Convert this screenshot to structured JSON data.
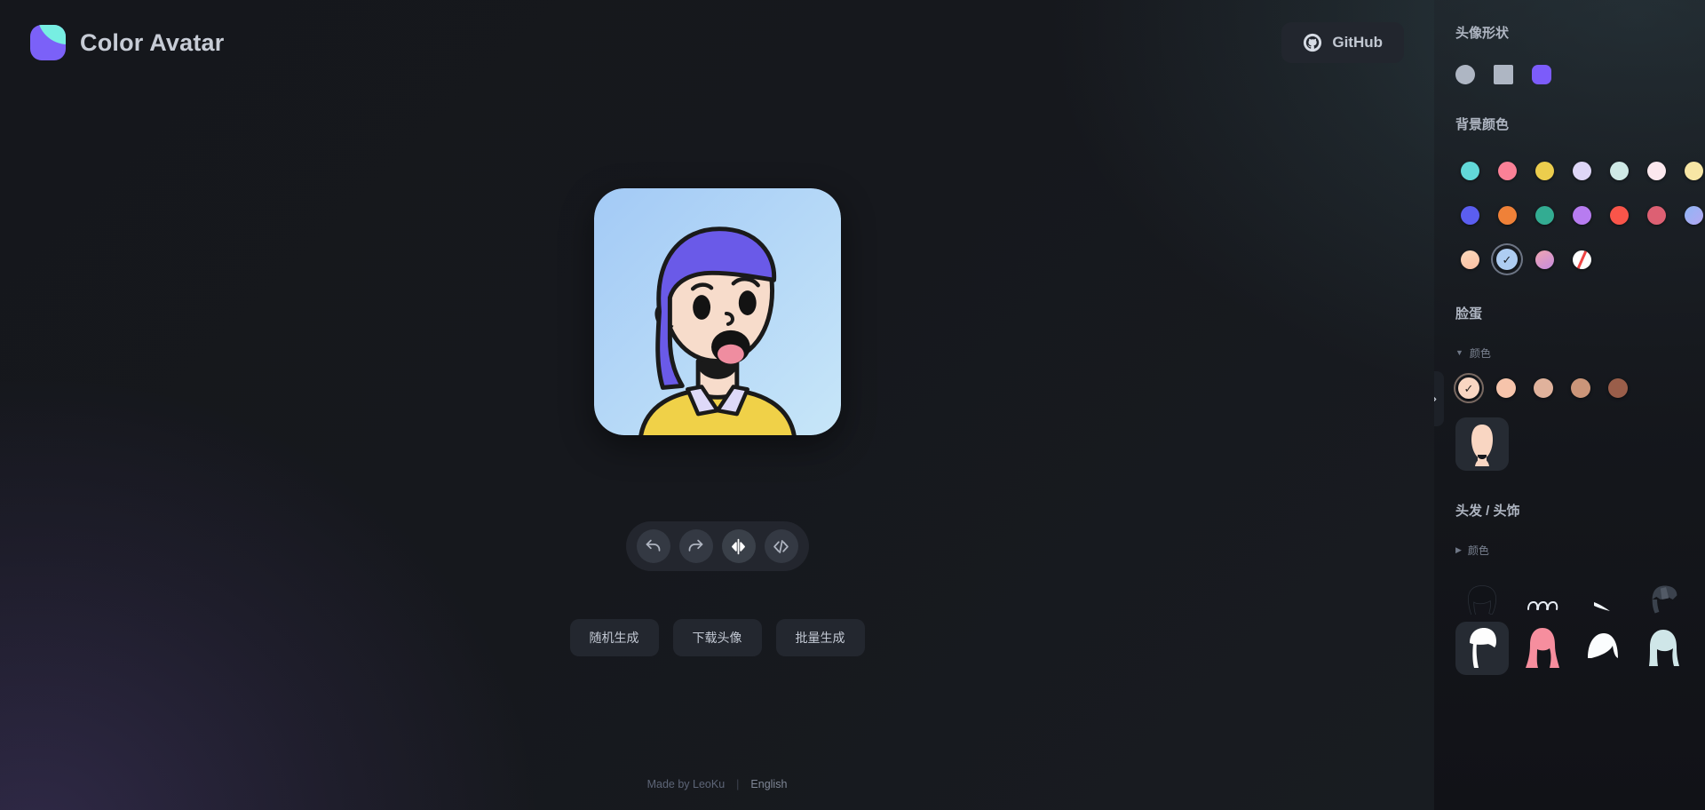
{
  "app": {
    "brand_title": "Color Avatar",
    "logo_icon": "color-avatar-logo",
    "logo_colors": {
      "base": "#7b61f8",
      "accent": "#77eee2"
    }
  },
  "header": {
    "github_label": "GitHub",
    "github_icon": "github-icon"
  },
  "preview": {
    "shape": "rounded-square",
    "background": {
      "type": "linear-gradient",
      "from": "#a5cbf5",
      "to": "#c5e4f7"
    },
    "skin": "#f7dccb",
    "hair_color": "#6a5ae8",
    "shirt_color": "#f0d148",
    "collar_color": "#ded9f8",
    "mouth_color": "#ef8da0",
    "outline_color": "#1a1a1a"
  },
  "toolbar": {
    "buttons": [
      {
        "name": "undo",
        "icon": "undo-icon",
        "active": false
      },
      {
        "name": "redo",
        "icon": "redo-icon",
        "active": false
      },
      {
        "name": "flip",
        "icon": "flip-horizontal-icon",
        "active": true
      },
      {
        "name": "code",
        "icon": "code-icon",
        "active": false
      }
    ]
  },
  "actions": {
    "random_label": "随机生成",
    "download_label": "下载头像",
    "batch_label": "批量生成"
  },
  "footer": {
    "made_by": "Made by LeoKu",
    "separator": "|",
    "language": "English"
  },
  "sidebar": {
    "collapse_icon": "chevron-right-icon",
    "shape_section": {
      "title": "头像形状",
      "selected_index": 2,
      "options": [
        {
          "name": "circle",
          "shape": "circle",
          "color": "#aeb6c3"
        },
        {
          "name": "square",
          "shape": "square",
          "color": "#aeb6c3"
        },
        {
          "name": "rounded",
          "shape": "rounded",
          "color": "#7c5cfa"
        }
      ]
    },
    "background_section": {
      "title": "背景颜色",
      "selected_index": 15,
      "swatches": [
        {
          "name": "turquoise",
          "color": "#62d8d8"
        },
        {
          "name": "coral-pink",
          "color": "#fb8197"
        },
        {
          "name": "golden-yellow",
          "color": "#eccd4d"
        },
        {
          "name": "pale-lavender",
          "color": "#ded6f7"
        },
        {
          "name": "pale-mint",
          "color": "#cfe9e6"
        },
        {
          "name": "pale-pink",
          "color": "#fbe8ee"
        },
        {
          "name": "pale-yellow",
          "color": "#f7e6a5"
        },
        {
          "name": "indigo-blue",
          "color": "#5b5ef0"
        },
        {
          "name": "orange",
          "color": "#ef8138"
        },
        {
          "name": "teal-green",
          "color": "#33ac92"
        },
        {
          "name": "purple",
          "color": "#b77cf0"
        },
        {
          "name": "red-orange",
          "color": "#f9554a"
        },
        {
          "name": "rose",
          "color": "#dd6073"
        },
        {
          "name": "blue-violet-gradient",
          "color": "linear-gradient(135deg,#8fb6f5,#b4a7f2)"
        },
        {
          "name": "peach-gradient",
          "color": "linear-gradient(160deg,#fad9bc,#fbbfa2)"
        },
        {
          "name": "light-blue",
          "color": "#aecdf2"
        },
        {
          "name": "pink-purple-gradient",
          "color": "linear-gradient(150deg,#f0a5b0,#c58ce0)"
        },
        {
          "name": "none",
          "color": "none"
        }
      ],
      "check_glyph": "✓"
    },
    "face_section": {
      "title": "脸蛋",
      "color_group_label": "颜色",
      "color_group_expanded": true,
      "expanded_caret": "▼",
      "selected_tone_index": 0,
      "check_glyph": "✓",
      "tones": [
        {
          "name": "tone-1",
          "color": "#f9d6c2"
        },
        {
          "name": "tone-2",
          "color": "#f6c4ab"
        },
        {
          "name": "tone-3",
          "color": "#e0b29c"
        },
        {
          "name": "tone-4",
          "color": "#cb9579"
        },
        {
          "name": "tone-5",
          "color": "#9a5e4a"
        }
      ],
      "shapes": [
        {
          "name": "face-shape-oval",
          "selected": true,
          "fill": "#f9d6c2"
        }
      ]
    },
    "hair_section": {
      "title": "头发 / 头饰",
      "color_group_label": "颜色",
      "color_group_expanded": false,
      "collapsed_caret": "▶",
      "top_row_partial": [
        {
          "name": "hair-style-dark-bob",
          "fill": "#111318"
        },
        {
          "name": "hair-style-curls",
          "fill": "#e8eef5"
        },
        {
          "name": "hair-style-small",
          "fill": "#f2f6fa"
        },
        {
          "name": "hair-style-cap",
          "fill": "#3b424d"
        }
      ],
      "bottom_row": [
        {
          "name": "hair-style-side-swoop",
          "fill": "#fdfdfd",
          "selected": true
        },
        {
          "name": "hair-style-long-pink",
          "fill": "#f68e9e",
          "selected": false
        },
        {
          "name": "hair-style-short-white",
          "fill": "#fbfdfe",
          "selected": false
        },
        {
          "name": "hair-style-bob-mint",
          "fill": "#cfe6e8",
          "selected": false
        }
      ]
    }
  }
}
